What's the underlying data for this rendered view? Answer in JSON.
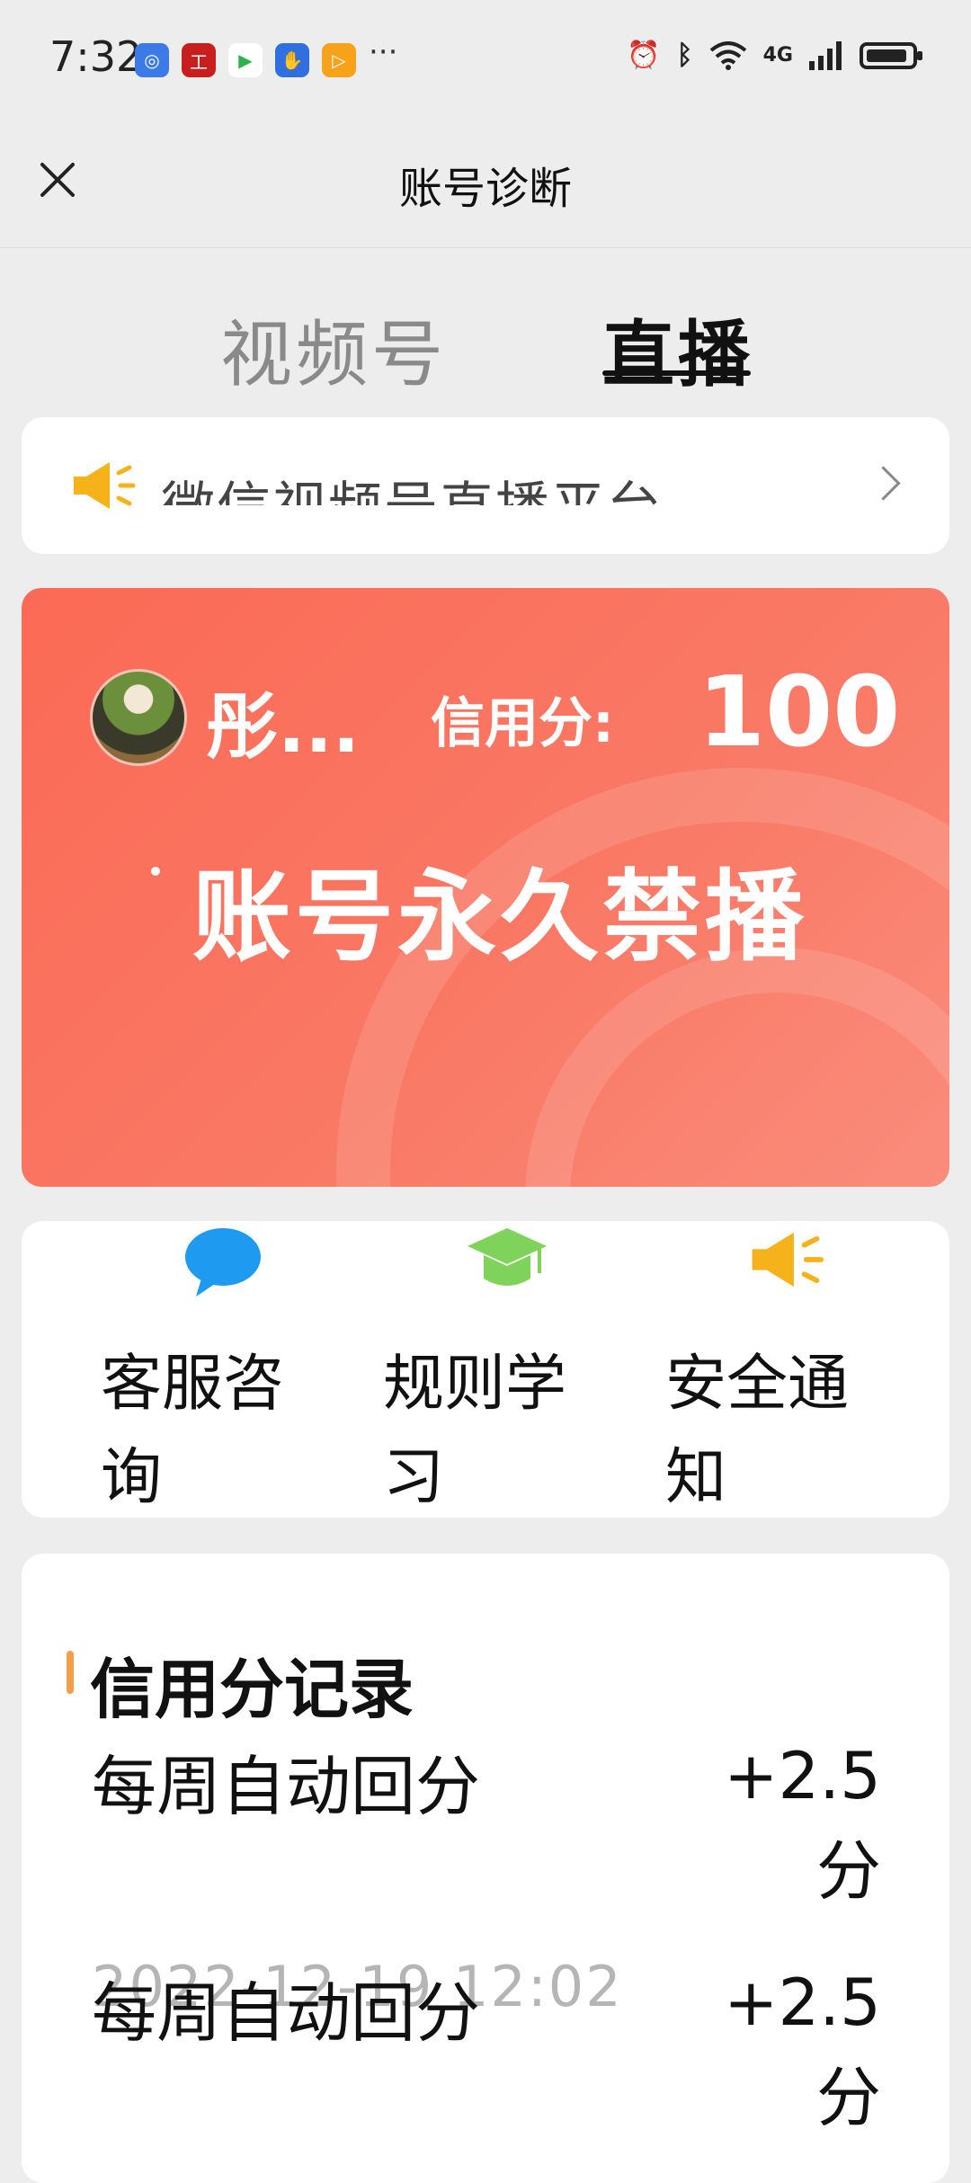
{
  "statusbar": {
    "time": "7:32",
    "app_icons": [
      {
        "name": "browser-icon",
        "color": "#3c7ae8",
        "glyph": "◎"
      },
      {
        "name": "bank-app-icon",
        "color": "#c81e1e",
        "glyph": "工"
      },
      {
        "name": "video-app-icon",
        "color": "#ffffff",
        "glyph": "▶"
      },
      {
        "name": "assistant-app-icon",
        "color": "#2f6fe0",
        "glyph": "✋"
      },
      {
        "name": "media-app-icon",
        "color": "#f7a21b",
        "glyph": "▷"
      }
    ],
    "more": "···",
    "network": "4G"
  },
  "header": {
    "title": "账号诊断"
  },
  "tabs": [
    {
      "label": "视频号",
      "active": false
    },
    {
      "label": "直播",
      "active": true
    }
  ],
  "notice": {
    "text": "微信视频号直播平台"
  },
  "account": {
    "nickname": "彤...",
    "credit_label": "信用分:",
    "credit_score": "100",
    "status": "账号永久禁播"
  },
  "actions": [
    {
      "label": "客服咨询",
      "icon": "chat-bubble-icon",
      "color": "#1e9bf0"
    },
    {
      "label": "规则学习",
      "icon": "graduation-cap-icon",
      "color": "#7fd35a"
    },
    {
      "label": "安全通知",
      "icon": "speaker-icon",
      "color": "#f5b21a"
    }
  ],
  "records": {
    "title": "信用分记录",
    "items": [
      {
        "name": "每周自动回分",
        "points": "+2.5分",
        "time": "2022-12-19 12:02"
      },
      {
        "name": "每周自动回分",
        "points": "+2.5分",
        "time": ""
      }
    ]
  }
}
